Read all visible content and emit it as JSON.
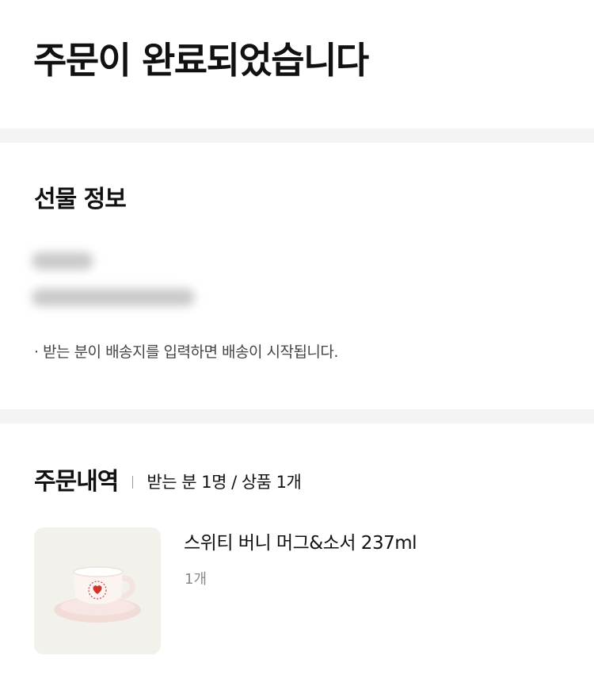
{
  "header": {
    "title": "주문이 완료되었습니다"
  },
  "gift_info": {
    "title": "선물 정보",
    "notice": "· 받는 분이 배송지를 입력하면 배송이 시작됩니다."
  },
  "order": {
    "title": "주문내역",
    "summary": "받는 분 1명 / 상품 1개",
    "items": [
      {
        "name": "스위티 버니 머그&소서 237ml",
        "quantity": "1개",
        "thumbnail_icon": "mug-saucer-image"
      }
    ]
  },
  "colors": {
    "divider": "#f4f4f4",
    "thumbnail_bg": "#f3f1ec",
    "heart": "#d0342c",
    "secondary_text": "#888888"
  }
}
